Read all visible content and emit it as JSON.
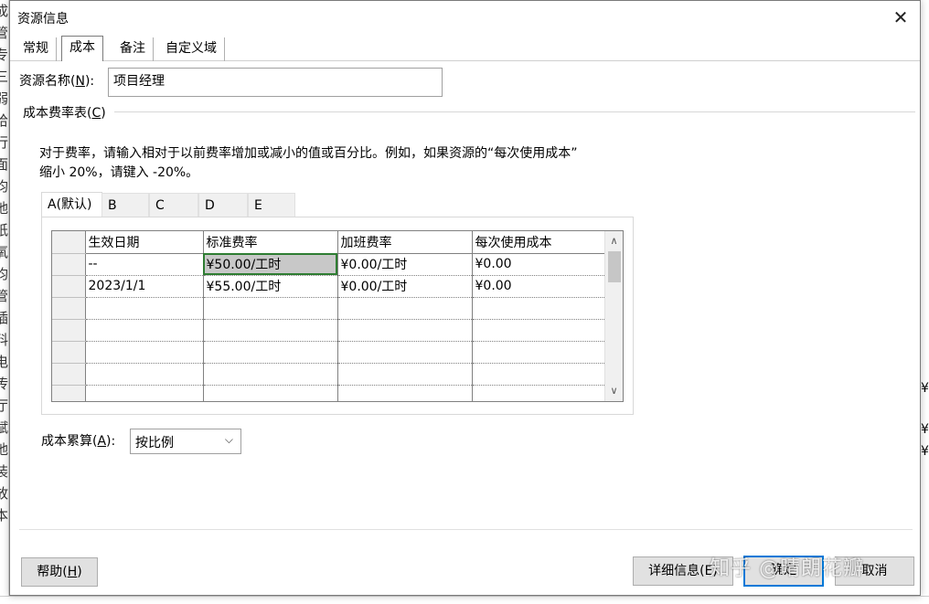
{
  "background": {
    "left_chars": [
      "成",
      "管",
      "专",
      "三",
      "弱",
      "给",
      "行",
      "面",
      "均",
      "地",
      "纸",
      "氧",
      "均",
      "管",
      "插",
      "料",
      "电",
      "传",
      "厅",
      "赋",
      "地",
      "装",
      "放",
      "本"
    ],
    "right_cells": [
      "¥(",
      "¥(",
      "¥("
    ]
  },
  "dialog": {
    "title": "资源信息",
    "close_symbol": "✕",
    "tabs": [
      {
        "label": "常规"
      },
      {
        "label": "成本"
      },
      {
        "label": "备注"
      },
      {
        "label": "自定义域"
      }
    ],
    "resource_name_label": "资源名称(",
    "resource_name_key": "N",
    "resource_name_label_end": "):",
    "resource_name_value": "项目经理",
    "cost_table_label": "成本费率表(",
    "cost_table_key": "C",
    "cost_table_label_end": ")",
    "instruction_line1": "对于费率，请输入相对于以前费率增加或减小的值或百分比。例如，如果资源的“每次使用成本”",
    "instruction_line2": "缩小 20%，请键入 -20%。",
    "rate_tabs": [
      "A(默认)",
      "B",
      "C",
      "D",
      "E"
    ],
    "grid": {
      "columns": [
        "生效日期",
        "标准费率",
        "加班费率",
        "每次使用成本"
      ],
      "rows": [
        [
          "--",
          "¥50.00/工时",
          "¥0.00/工时",
          "¥0.00"
        ],
        [
          "2023/1/1",
          "¥55.00/工时",
          "¥0.00/工时",
          "¥0.00"
        ],
        [
          "",
          "",
          "",
          ""
        ],
        [
          "",
          "",
          "",
          ""
        ],
        [
          "",
          "",
          "",
          ""
        ],
        [
          "",
          "",
          "",
          ""
        ],
        [
          "",
          "",
          "",
          ""
        ]
      ],
      "scroll_up": "∧",
      "scroll_down": "∨"
    },
    "accrue_label": "成本累算(",
    "accrue_key": "A",
    "accrue_label_end": "):",
    "accrue_value": "按比例",
    "accrue_dropdown_symbol": "⌵",
    "buttons": {
      "help_text": "帮助(",
      "help_key": "H",
      "help_end": ")",
      "details": "详细信息(E)",
      "ok": "确定",
      "cancel": "取消"
    }
  },
  "watermark": "知乎 @晴朗花瓣",
  "colors": {
    "selected_cell_border": "#2e7d32",
    "selected_cell_bg": "#c8c8c8",
    "default_button_border": "#0078d7"
  }
}
